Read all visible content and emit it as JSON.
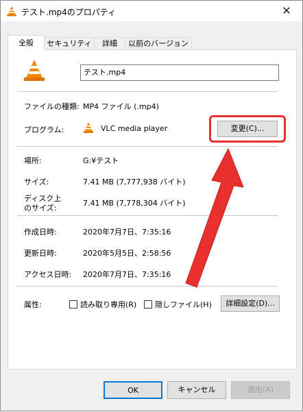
{
  "window": {
    "title": "テスト.mp4のプロパティ",
    "close_label": "✕"
  },
  "tabs": [
    {
      "label": "全般"
    },
    {
      "label": "セキュリティ"
    },
    {
      "label": "詳細"
    },
    {
      "label": "以前のバージョン"
    }
  ],
  "file": {
    "name_value": "テスト.mp4"
  },
  "fields": {
    "type_label": "ファイルの種類:",
    "type_value": "MP4 ファイル (.mp4)",
    "program_label": "プログラム:",
    "program_value": "VLC media player",
    "change_button": "変更(C)...",
    "location_label": "場所:",
    "location_value": "G:¥テスト",
    "size_label": "サイズ:",
    "size_value": "7.41 MB (7,777,938 バイト)",
    "disk_size_label_1": "ディスク上",
    "disk_size_label_2": "のサイズ:",
    "disk_size_value": "7.41 MB (7,778,304 バイト)",
    "created_label": "作成日時:",
    "created_value": "2020年7月7日、7:35:16",
    "modified_label": "更新日時:",
    "modified_value": "2020年5月5日、2:58:56",
    "accessed_label": "アクセス日時:",
    "accessed_value": "2020年7月7日、7:35:16",
    "attributes_label": "属性:",
    "readonly_label": "読み取り専用(R)",
    "hidden_label": "隠しファイル(H)",
    "advanced_button": "詳細設定(D)..."
  },
  "footer": {
    "ok": "OK",
    "cancel": "キャンセル",
    "apply": "適用(A)"
  },
  "colors": {
    "accent": "#0078d7",
    "highlight": "#e8312f",
    "vlc_orange": "#f08a00"
  }
}
